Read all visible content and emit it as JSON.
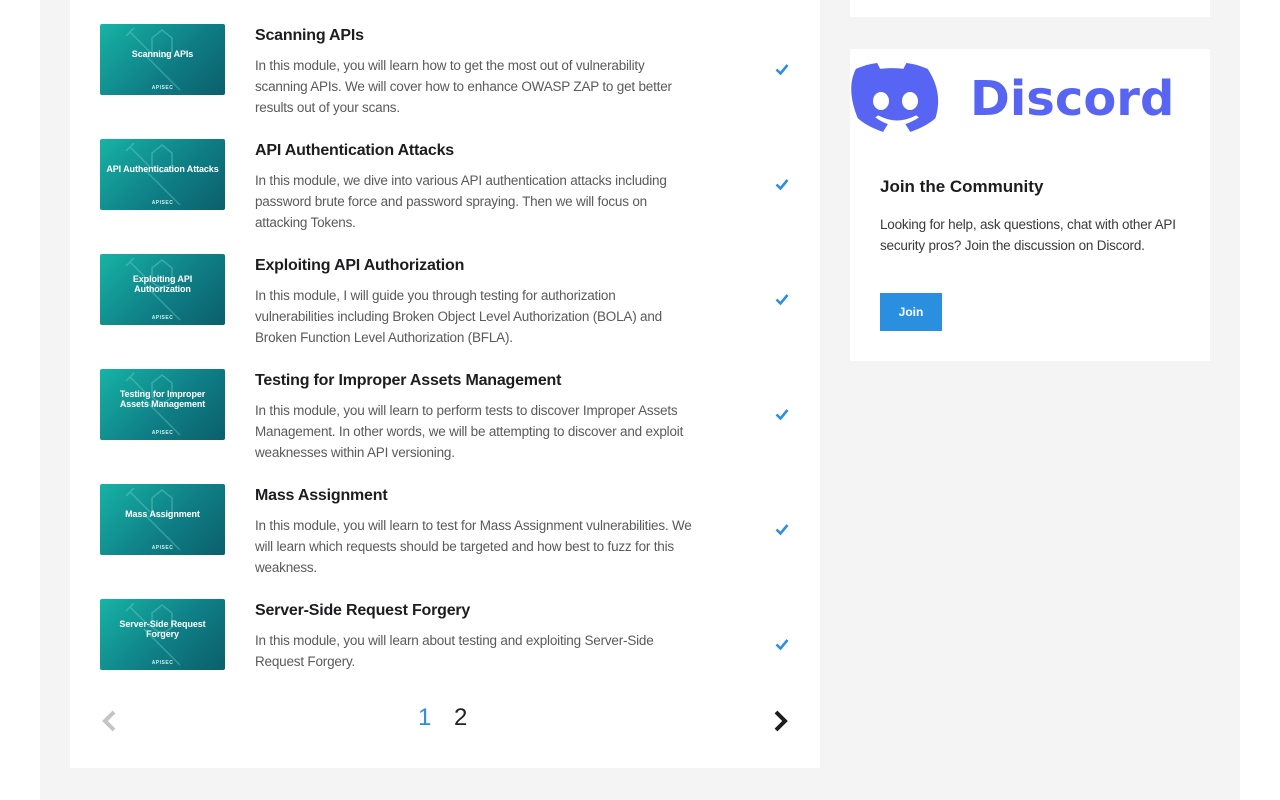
{
  "modules": [
    {
      "thumb_label": "Scanning APIs",
      "title": "Scanning APIs",
      "description": "In this module, you will learn how to get the most out of vulnerability scanning APIs. We will cover how to enhance OWASP ZAP to get better results out of your scans.",
      "completed": true
    },
    {
      "thumb_label": "API Authentication Attacks",
      "title": "API Authentication Attacks",
      "description": "In this module, we dive into various API authentication attacks including password brute force and password spraying. Then we will focus on attacking Tokens.",
      "completed": true
    },
    {
      "thumb_label": "Exploiting API Authorization",
      "title": "Exploiting API Authorization",
      "description": "In this module, I will guide you through testing for authorization vulnerabilities including Broken Object Level Authorization (BOLA) and Broken Function Level Authorization (BFLA).",
      "completed": true
    },
    {
      "thumb_label": "Testing for Improper Assets Management",
      "title": "Testing for Improper Assets Management",
      "description": "In this module, you will learn to perform tests to discover Improper Assets Management. In other words, we will be attempting to discover and exploit weaknesses within API versioning.",
      "completed": true
    },
    {
      "thumb_label": "Mass Assignment",
      "title": "Mass Assignment",
      "description": "In this module, you will learn to test for Mass Assignment vulnerabilities. We will learn which requests should be targeted and how best to fuzz for this weakness.",
      "completed": true
    },
    {
      "thumb_label": "Server-Side Request Forgery",
      "title": "Server-Side Request Forgery",
      "description": "In this module, you will learn about testing and exploiting Server-Side Request Forgery.",
      "completed": true
    }
  ],
  "thumb_brand": "APISEC",
  "pagination": {
    "pages": [
      "1",
      "2"
    ],
    "current": "1"
  },
  "community": {
    "logo_text": "Discord",
    "title": "Join the Community",
    "text": "Looking for help, ask questions, chat with other API security pros? Join the discussion on Discord.",
    "button_label": "Join"
  },
  "colors": {
    "accent": "#2b8fe0",
    "discord": "#5865f2",
    "thumb_teal": "#17b3a6"
  }
}
